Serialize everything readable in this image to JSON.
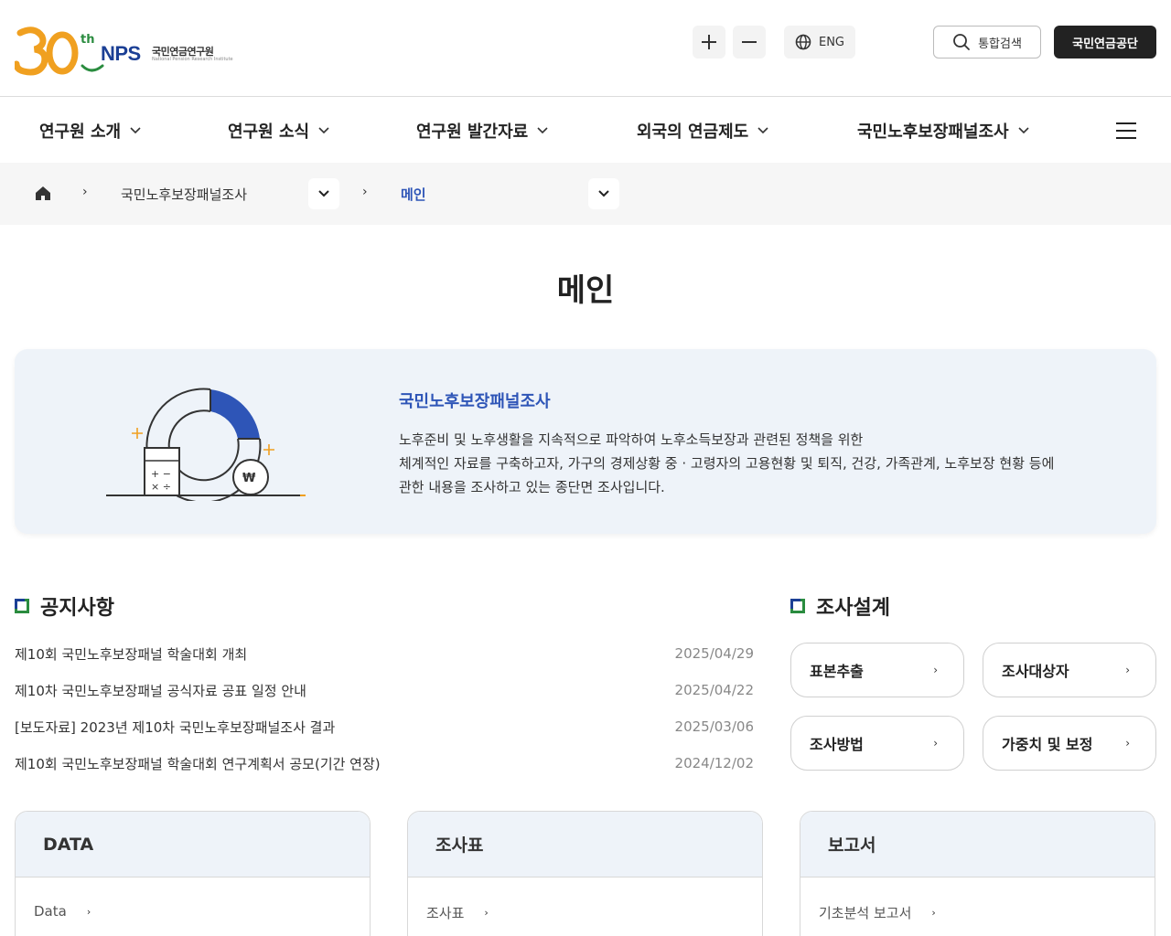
{
  "header": {
    "logo_mark": "30",
    "logo_sup": "th",
    "logo_brand": "NPS",
    "logo_org": "국민연금연구원",
    "logo_org_en": "National Pension Research Institute",
    "zoom_in_icon": "plus-icon",
    "zoom_out_icon": "minus-icon",
    "lang_label": "ENG",
    "search_label": "통합검색",
    "nps_label": "국민연금공단"
  },
  "nav": {
    "items": [
      {
        "label": "연구원 소개"
      },
      {
        "label": "연구원 소식"
      },
      {
        "label": "연구원 발간자료"
      },
      {
        "label": "외국의 연금제도"
      },
      {
        "label": "국민노후보장패널조사"
      }
    ]
  },
  "breadcrumb": {
    "level1": "국민노후보장패널조사",
    "level2": "메인"
  },
  "page": {
    "title": "메인"
  },
  "intro": {
    "title": "국민노후보장패널조사",
    "lines": [
      "노후준비 및 노후생활을 지속적으로 파악하여 노후소득보장과 관련된 정책을 위한",
      "체계적인 자료를 구축하고자, 가구의 경제상황 중 · 고령자의 고용현황 및 퇴직, 건강, 가족관계, 노후보장 현황 등에",
      "관한 내용을 조사하고 있는 종단면 조사입니다."
    ]
  },
  "notices": {
    "title": "공지사항",
    "items": [
      {
        "title": "제10회 국민노후보장패널 학술대회 개최",
        "date": "2025/04/29"
      },
      {
        "title": "제10차 국민노후보장패널 공식자료 공표 일정 안내",
        "date": "2025/04/22"
      },
      {
        "title": "[보도자료] 2023년 제10차 국민노후보장패널조사 결과",
        "date": "2025/03/06"
      },
      {
        "title": "제10회 국민노후보장패널 학술대회 연구계획서 공모(기간 연장)",
        "date": "2024/12/02"
      }
    ]
  },
  "design": {
    "title": "조사설계",
    "buttons": [
      {
        "label": "표본추출"
      },
      {
        "label": "조사대상자"
      },
      {
        "label": "조사방법"
      },
      {
        "label": "가중치 및 보정"
      }
    ]
  },
  "cards": [
    {
      "title": "DATA",
      "link": "Data"
    },
    {
      "title": "조사표",
      "link": "조사표"
    },
    {
      "title": "보고서",
      "link": "기초분석 보고서"
    }
  ],
  "colors": {
    "accent_blue": "#2e55b7",
    "brand_navy": "#1b3f95",
    "logo_orange": "#f0a020",
    "mark_green": "#2a8c3f",
    "panel_bg": "#eef3f9"
  }
}
